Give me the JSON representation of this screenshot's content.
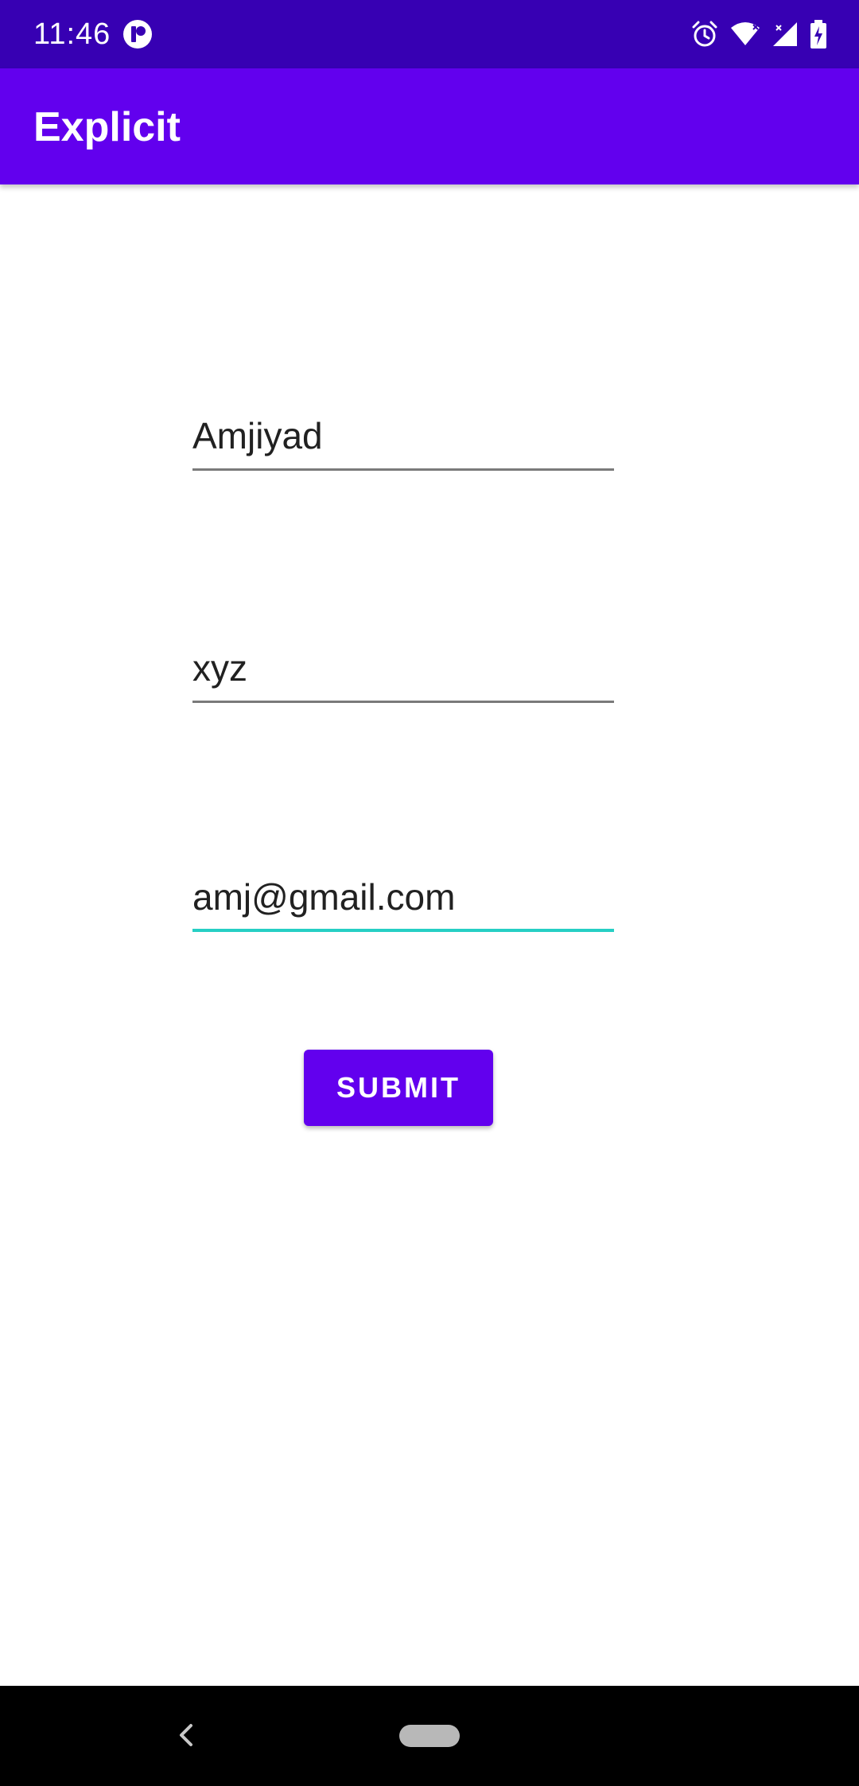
{
  "status_bar": {
    "time": "11:46",
    "icons": [
      "app-notification-icon",
      "alarm-icon",
      "wifi-icon",
      "signal-icon",
      "battery-charging-icon"
    ]
  },
  "app_bar": {
    "title": "Explicit"
  },
  "form": {
    "name_value": "Amjiyad",
    "second_value": "xyz",
    "email_value": "amj@gmail.com",
    "submit_label": "SUBMIT"
  },
  "colors": {
    "status_bar": "#3700b3",
    "primary": "#6200ee",
    "focus_accent": "#26cfc4"
  }
}
